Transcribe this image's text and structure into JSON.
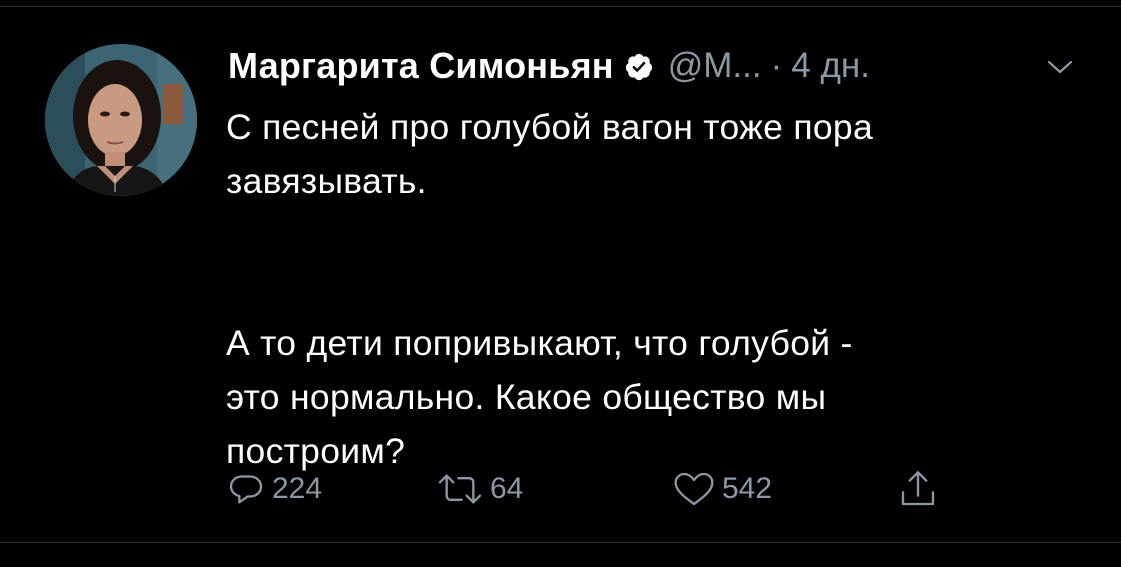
{
  "tweet": {
    "author_name": "Маргарита Симоньян",
    "handle": "@М...",
    "separator": "·",
    "time": "4 дн.",
    "lines": [
      "С песней про голубой вагон тоже пора",
      "завязывать.",
      "А то дети попривыкают, что голубой -",
      "это нормально. Какое общество мы",
      "построим?"
    ],
    "reply_count": "224",
    "retweet_count": "64",
    "like_count": "542"
  },
  "icons": {
    "verified": "verified-badge-icon",
    "caret": "chevron-down-icon",
    "reply": "reply-icon",
    "retweet": "retweet-icon",
    "like": "heart-icon",
    "share": "share-icon"
  },
  "colors": {
    "background": "#000000",
    "text": "#ffffff",
    "secondary": "#8b98a5",
    "divider": "#2f3336"
  }
}
